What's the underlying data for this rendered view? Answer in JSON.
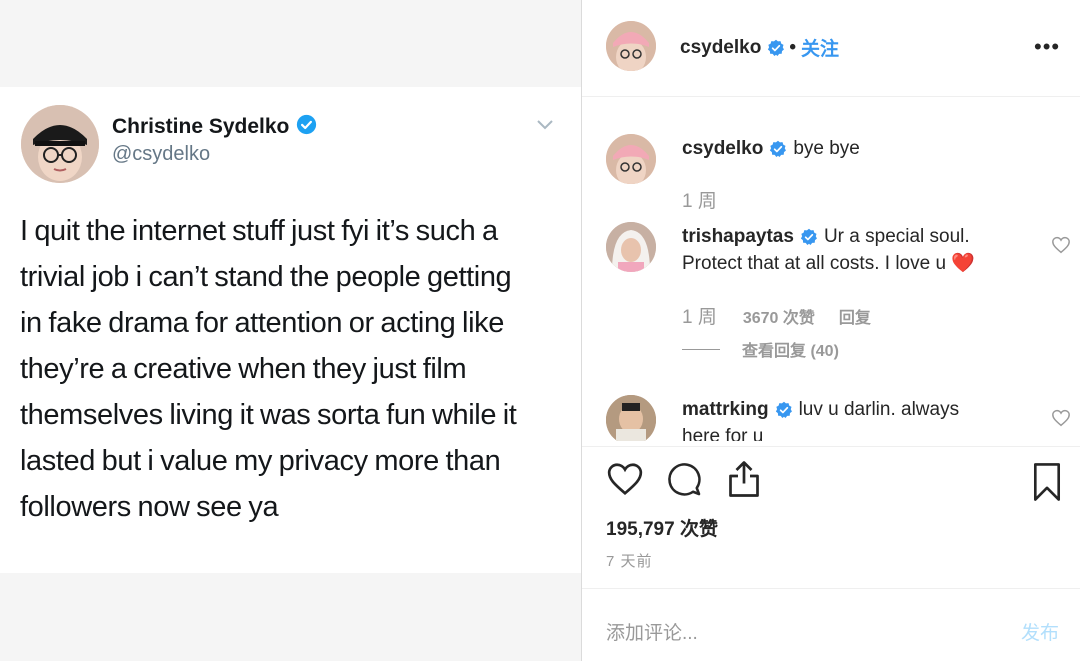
{
  "tweet": {
    "name": "Christine Sydelko",
    "handle": "@csydelko",
    "lines": [
      "I quit the internet stuff just fyi it’s such a",
      "trivial job i can’t stand the people getting",
      "in fake drama for attention or acting like",
      "they’re a creative when they just film",
      "themselves living it was sorta fun while it",
      "lasted but i value my privacy more than",
      "followers now see ya"
    ]
  },
  "instagram": {
    "header": {
      "username": "csydelko",
      "separator": "•",
      "follow_label": "关注",
      "more_label": "•••"
    },
    "caption": {
      "username": "csydelko",
      "text": "bye bye",
      "age": "1 周"
    },
    "comments": [
      {
        "username": "trishapaytas",
        "text_line1": "Ur a special soul.",
        "text_line2": "Protect that at all costs. I love u",
        "emoji": "❤️",
        "age": "1 周",
        "likes": "3670 次赞",
        "reply_label": "回复",
        "view_replies": "查看回复 (40)"
      },
      {
        "username": "mattrking",
        "text_line1": "luv u darlin. always",
        "text_line2": "here for u"
      }
    ],
    "likes_count": "195,797 次赞",
    "post_age": "7 天前",
    "add_comment_placeholder": "添加评论...",
    "post_button": "发布"
  },
  "colors": {
    "verified": "#3897f0",
    "tw_verified": "#1da1f2",
    "link": "#3897f0",
    "muted": "#999999"
  },
  "icons": [
    "verified-badge-icon",
    "chevron-down-icon",
    "more-icon",
    "heart-icon",
    "comment-icon",
    "share-icon",
    "bookmark-icon"
  ]
}
